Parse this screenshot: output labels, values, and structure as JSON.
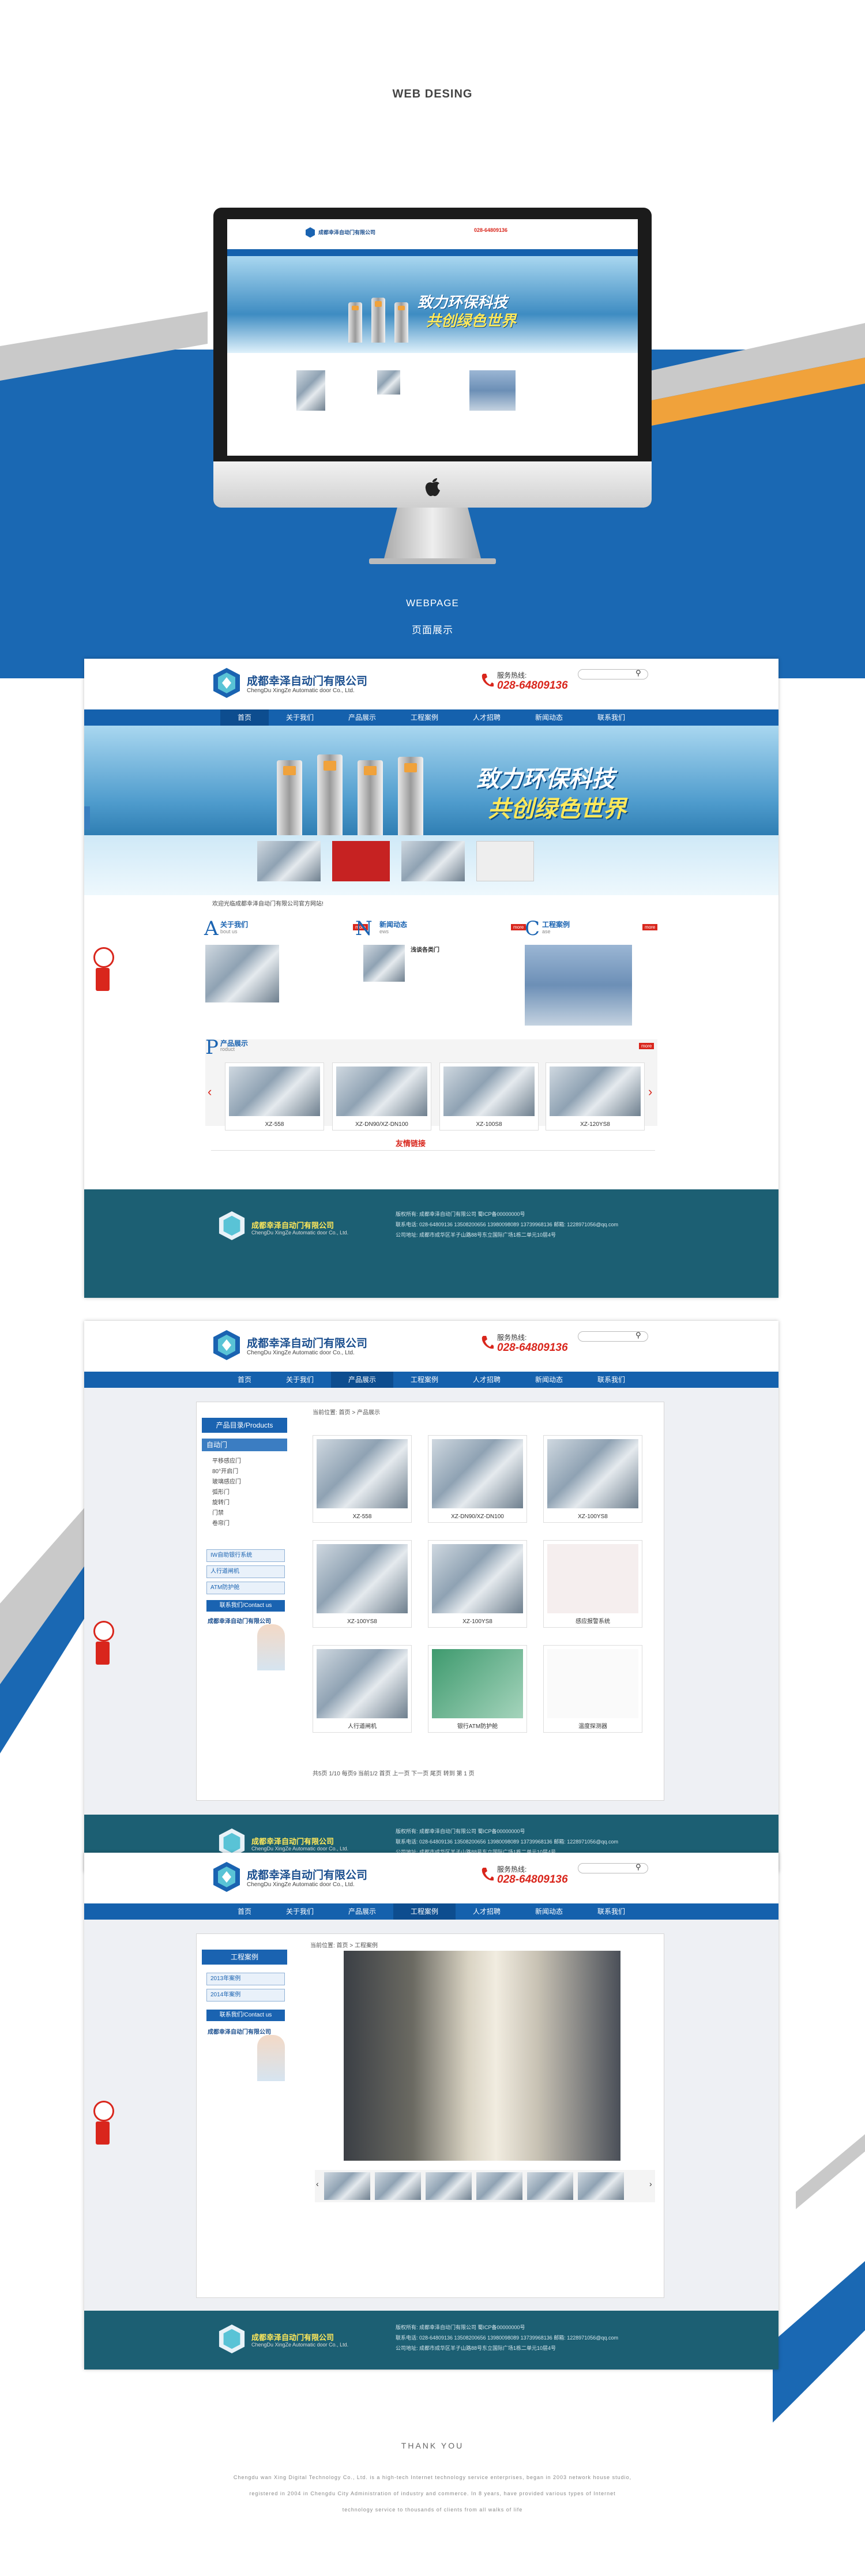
{
  "heading": "WEB DESING",
  "subheading_en": "WEBPAGE",
  "subheading_cn": "页面展示",
  "company": {
    "name_cn": "成都幸泽自动门有限公司",
    "name_en": "ChengDu XingZe Automatic door Co., Ltd.",
    "hotline_label": "服务热线:",
    "hotline_number": "028-64809136",
    "footer_name": "成都幸泽自动门有限公司"
  },
  "nav": [
    "首页",
    "关于我们",
    "产品展示",
    "工程案例",
    "人才招聘",
    "新闻动态",
    "联系我们"
  ],
  "banner": {
    "slogan_1": "致力环保科技",
    "slogan_2": "共创绿色世界"
  },
  "notice": "欢迎光临成都幸泽自动门有限公司官方网站!",
  "home_sections": {
    "about": {
      "letter": "A",
      "title": "关于我们",
      "en": "bout us",
      "more": "more"
    },
    "news": {
      "letter": "N",
      "title": "新闻动态",
      "en": "ews",
      "more": "more",
      "headline": "浅谈各类门"
    },
    "cases": {
      "letter": "C",
      "title": "工程案例",
      "en": "ase",
      "more": "more"
    },
    "products": {
      "letter": "P",
      "title": "产品展示",
      "en": "roduct",
      "more": "more"
    }
  },
  "home_products": [
    "XZ-558",
    "XZ-DN90/XZ-DN100",
    "XZ-100S8",
    "XZ-120YS8"
  ],
  "links_title": "友情链接",
  "footer_lines": [
    "版权所有: 成都幸泽自动门有限公司  蜀ICP备00000000号",
    "联系电话: 028-64809136  13508200656  13980098089  13739968136      邮箱: 1228971056@qq.com",
    "公司地址: 成都市成华区羊子山路88号东立国际广场1栋二单元10层4号"
  ],
  "products_page": {
    "breadcrumb": "当前位置: 首页 > 产品展示",
    "sidebar_title": "产品目录/Products",
    "sidebar_active": "自动门",
    "sidebar_items": [
      "平移感应门",
      "80°开启门",
      "玻璃感应门",
      "弧形门",
      "旋转门",
      "门禁",
      "卷帘门"
    ],
    "sidebar_buttons": [
      "IW自助银行系统",
      "人行道闸机",
      "ATM防护舱"
    ],
    "contact_title": "联系我们/Contact us",
    "contact_name": "成都幸泽自动门有限公司",
    "products": [
      {
        "caption": "XZ-558"
      },
      {
        "caption": "XZ-DN90/XZ-DN100"
      },
      {
        "caption": "XZ-100YS8"
      },
      {
        "caption": "XZ-100YS8"
      },
      {
        "caption": "XZ-100YS8"
      },
      {
        "caption": "感应报警系统"
      },
      {
        "caption": "人行道闸机"
      },
      {
        "caption": "银行ATM防护舱"
      },
      {
        "caption": "温度探测器"
      }
    ],
    "pagination": "共5页 1/10 每页9 当前1/2     首页  上一页  下一页  尾页  转到 第 1 页"
  },
  "cases_page": {
    "breadcrumb": "当前位置: 首页 > 工程案例",
    "sidebar_title": "工程案例",
    "sidebar_items": [
      "2013年案例",
      "2014年案例"
    ],
    "contact_title": "联系我们/Contact us",
    "contact_name": "成都幸泽自动门有限公司"
  },
  "thank_you": "THANK  YOU",
  "closing": [
    "Chengdu wan Xing Digital Technology Co., Ltd. is a high-tech Internet technology service enterprises, began in 2003 network house studio,",
    "registered in 2004 in Chengdu City Administration of industry and commerce. In 8 years, have provided various types of Internet",
    "technology service to thousands of clients from all walks of life"
  ],
  "colors": {
    "brand_blue": "#1561ad",
    "footer_teal": "#1c5f73",
    "accent_red": "#d9261c",
    "accent_orange": "#f0a23b"
  }
}
